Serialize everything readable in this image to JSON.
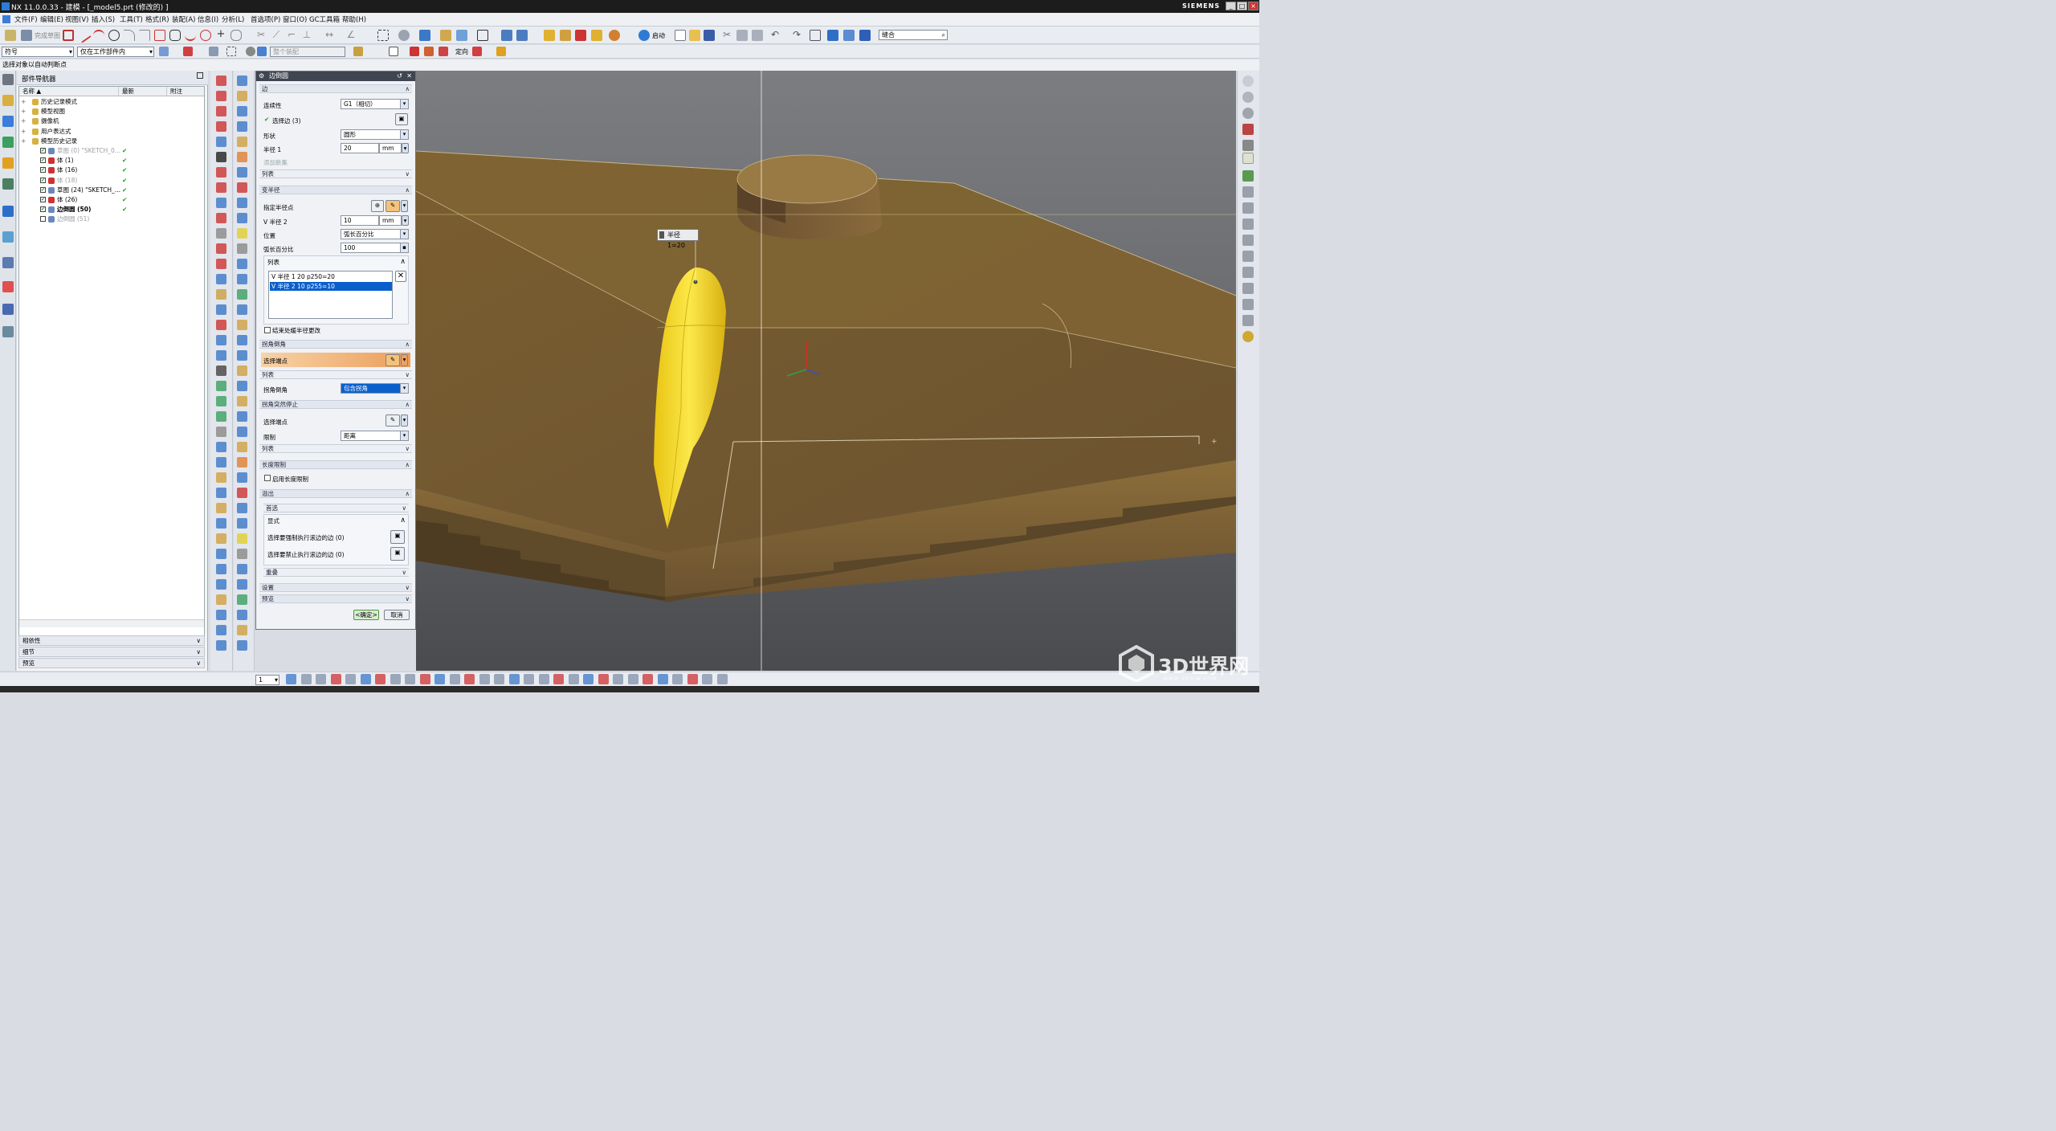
{
  "window": {
    "title": "NX 11.0.0.33 - 建模 - [_model5.prt  (修改的) ]",
    "brand": "SIEMENS"
  },
  "menu": [
    "文件(F)",
    "编辑(E)",
    "视图(V)",
    "插入(S)",
    "工具(T)",
    "格式(R)",
    "装配(A)",
    "信息(I)",
    "分析(L)",
    "首选项(P)",
    "窗口(O)",
    "GC工具箱",
    "帮助(H)"
  ],
  "toolbar": {
    "sketch_label": "完成草图",
    "search_value": "缝合",
    "start_label": "启动"
  },
  "selbar": {
    "filter": "符号",
    "scope": "仅在工作部件内",
    "assembly": "整个装配",
    "orient": "定向"
  },
  "status": "选择对象以自动判断点",
  "navigator": {
    "title": "部件导航器",
    "columns": [
      "名称",
      "最新",
      "附注"
    ],
    "rows": [
      {
        "label": "历史记录模式",
        "gray": false,
        "check": false,
        "indent": 0
      },
      {
        "label": "模型视图",
        "gray": false,
        "check": false,
        "indent": 0
      },
      {
        "label": "摄像机",
        "gray": false,
        "check": false,
        "indent": 0
      },
      {
        "label": "用户表达式",
        "gray": false,
        "check": false,
        "indent": 0
      },
      {
        "label": "模型历史记录",
        "gray": false,
        "check": false,
        "indent": 0
      },
      {
        "label": "草图 (0) \"SKETCH_0...",
        "gray": true,
        "check": true,
        "indent": 1
      },
      {
        "label": "体 (1)",
        "gray": false,
        "check": true,
        "indent": 1
      },
      {
        "label": "体 (16)",
        "gray": false,
        "check": true,
        "indent": 1
      },
      {
        "label": "体 (18)",
        "gray": true,
        "check": true,
        "indent": 1
      },
      {
        "label": "草图 (24) \"SKETCH_...",
        "gray": false,
        "check": true,
        "indent": 1
      },
      {
        "label": "体 (26)",
        "gray": false,
        "check": true,
        "indent": 1
      },
      {
        "label": "边倒圆 (50)",
        "gray": false,
        "check": true,
        "indent": 1,
        "bold": true
      },
      {
        "label": "边倒圆 (51)",
        "gray": true,
        "check": false,
        "indent": 1
      }
    ],
    "sections": [
      "相依性",
      "细节",
      "预览"
    ]
  },
  "dialog": {
    "title": "边倒圆",
    "edge_group": "边",
    "continuity_label": "连续性",
    "continuity_value": "G1（相切）",
    "select_edges": "选择边 (3)",
    "shape_label": "形状",
    "shape_value": "圆形",
    "radius1_label": "半径 1",
    "radius1_value": "20",
    "unit_mm": "mm",
    "add_set": "添加新集",
    "list_label": "列表",
    "var_group": "变半径",
    "specify_point": "指定半径点",
    "vr2_label": "V 半径 2",
    "vr2_value": "10",
    "position_label": "位置",
    "position_value": "弧长百分比",
    "arc_pct_label": "弧长百分比",
    "arc_pct_value": "100",
    "vlist_label": "列表",
    "vlist": [
      "V 半径 1  20  p250=20",
      "V 半径 2  10  p255=10"
    ],
    "smooth_change": "结束处缓半径更改",
    "corner_setback_group": "拐角倒角",
    "select_vertex": "选择端点",
    "corner_list": "列表",
    "corner_label": "拐角倒角",
    "corner_value": "包含拐角",
    "stop_group": "拐角突然停止",
    "stop_vertex": "选择端点",
    "limit_label": "限制",
    "limit_value": "距离",
    "stop_list": "列表",
    "length_group": "长度限制",
    "enable_length": "启用长度限制",
    "overflow_group": "溢出",
    "pref": "首选",
    "explicit": "显式",
    "force_roll": "选择要强制执行滚边的边 (0)",
    "prevent_roll": "选择要禁止执行滚边的边 (0)",
    "overlap": "重叠",
    "settings": "设置",
    "preview": "预览",
    "ok": "<确定>",
    "cancel": "取消"
  },
  "viewport": {
    "callout": "半径 1=20"
  },
  "bottom": {
    "num": "1"
  },
  "watermark": {
    "text": "3D世界网",
    "url": "WWW.3DSJW.COM"
  },
  "colors": {
    "body": "#8a6a35",
    "fillet": "#f2d21a",
    "accent": "#0a5fcc"
  }
}
